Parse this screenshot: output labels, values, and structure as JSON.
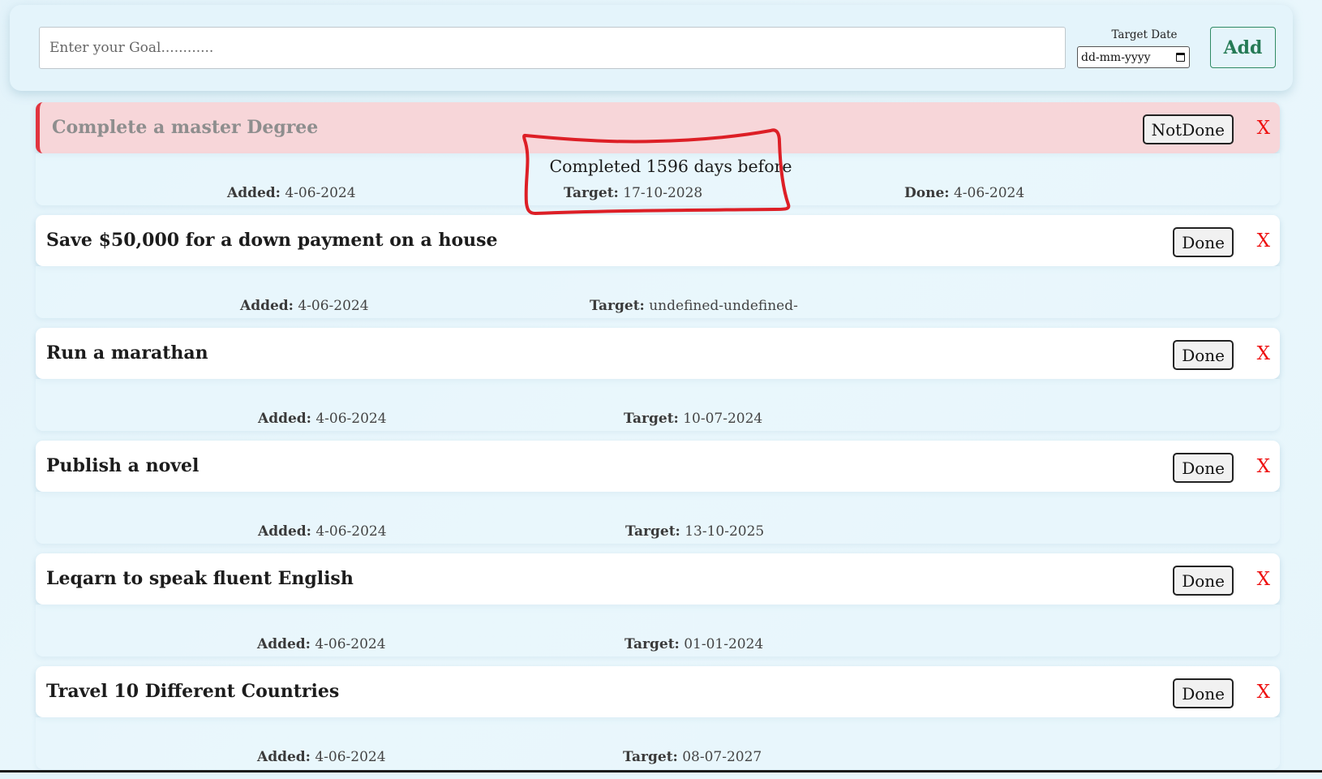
{
  "form": {
    "goal_placeholder": "Enter your Goal............",
    "target_date_label": "Target Date",
    "date_placeholder": "dd-mm-yyyy",
    "add_label": "Add"
  },
  "labels": {
    "added": "Added:",
    "target": "Target:",
    "done": "Done:"
  },
  "goals": [
    {
      "title": "Complete a master Degree",
      "status": "done",
      "button_label": "NotDone",
      "delete_label": "X",
      "completed_note": "Completed 1596 days before",
      "added": "4-06-2024",
      "target": "17-10-2028",
      "done": "4-06-2024"
    },
    {
      "title": "Save $50,000 for a down payment on a house",
      "status": "pending",
      "button_label": "Done",
      "delete_label": "X",
      "added": "4-06-2024",
      "target": "undefined-undefined-"
    },
    {
      "title": "Run a marathan",
      "status": "pending",
      "button_label": "Done",
      "delete_label": "X",
      "added": "4-06-2024",
      "target": "10-07-2024"
    },
    {
      "title": "Publish a novel",
      "status": "pending",
      "button_label": "Done",
      "delete_label": "X",
      "added": "4-06-2024",
      "target": "13-10-2025"
    },
    {
      "title": "Leqarn to speak fluent English",
      "status": "pending",
      "button_label": "Done",
      "delete_label": "X",
      "added": "4-06-2024",
      "target": "01-01-2024"
    },
    {
      "title": "Travel 10 Different Countries",
      "status": "pending",
      "button_label": "Done",
      "delete_label": "X",
      "added": "4-06-2024",
      "target": "08-07-2027"
    }
  ],
  "colors": {
    "done_background": "#f7d6d9",
    "done_accent": "#e1343f",
    "add_button": "#257a55",
    "delete": "#ee1111",
    "annotation": "#dd1f26"
  }
}
